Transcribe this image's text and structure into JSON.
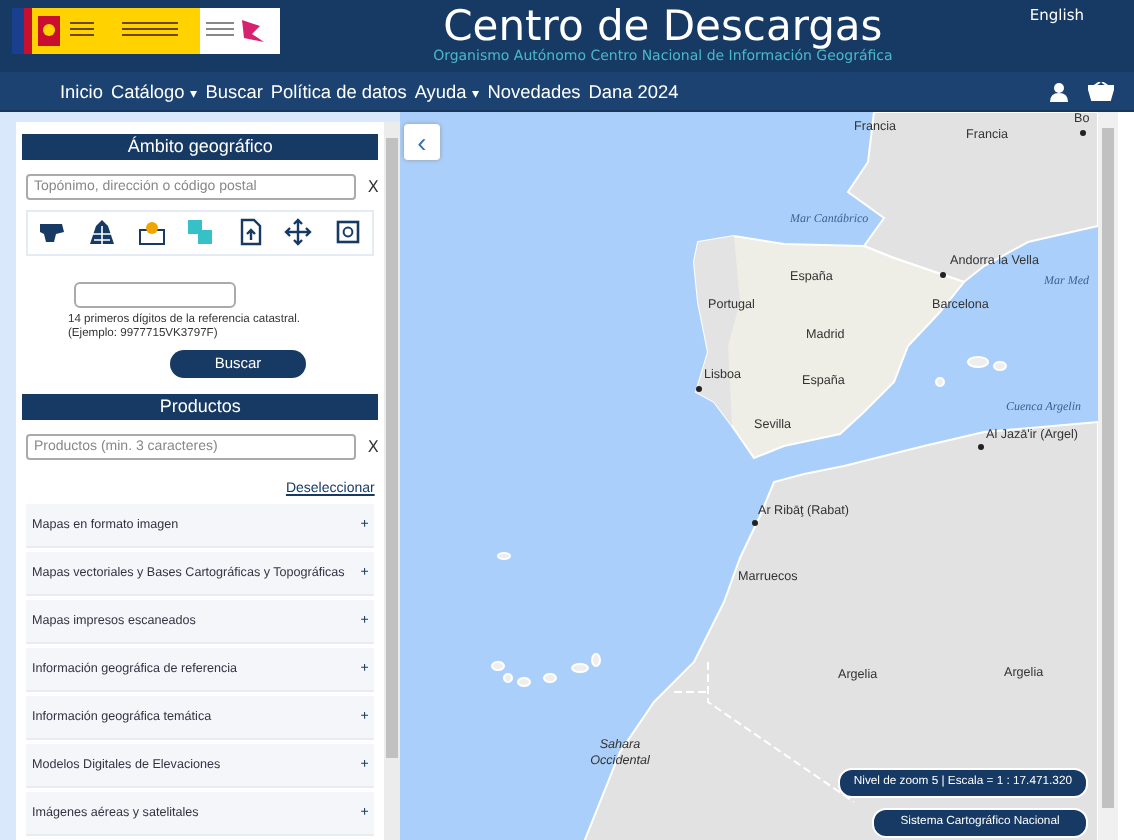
{
  "header": {
    "title": "Centro de Descargas",
    "subtitle": "Organismo Autónomo Centro Nacional de Información Geográfica",
    "language": "English"
  },
  "nav": {
    "items": [
      {
        "label": "Inicio"
      },
      {
        "label": "Catálogo",
        "caret": "▾"
      },
      {
        "label": "Buscar"
      },
      {
        "label": "Política de datos"
      },
      {
        "label": "Ayuda",
        "caret": "▾"
      },
      {
        "label": "Novedades"
      },
      {
        "label": "Dana 2024"
      }
    ]
  },
  "geo_panel": {
    "title": "Ámbito geográfico",
    "search": {
      "placeholder": "Topónimo, dirección o código postal"
    },
    "clear": "X",
    "tools": [
      {
        "selected": false
      },
      {
        "selected": false
      },
      {
        "selected": false
      },
      {
        "selected": true
      },
      {
        "selected": false
      },
      {
        "selected": false
      },
      {
        "selected": false
      }
    ],
    "cadastral": {
      "hint_lines": [
        "14 primeros dígitos de la referencia catastral.",
        "(Ejemplo: 9977715VK3797F)"
      ],
      "button": "Buscar"
    }
  },
  "products_panel": {
    "title": "Productos",
    "search": {
      "placeholder": "Productos (min. 3 caracteres)"
    },
    "clear": "X",
    "deselect": "Deseleccionar",
    "categories": [
      {
        "label": "Mapas en formato imagen",
        "expander": "+"
      },
      {
        "label": "Mapas vectoriales y Bases Cartográficas y Topográficas",
        "expander": "+"
      },
      {
        "label": "Mapas impresos escaneados",
        "expander": "+"
      },
      {
        "label": "Información geográfica de referencia",
        "expander": "+"
      },
      {
        "label": "Información geográfica temática",
        "expander": "+"
      },
      {
        "label": "Modelos Digitales de Elevaciones",
        "expander": "+"
      },
      {
        "label": "Imágenes aéreas y satelitales",
        "expander": "+"
      }
    ]
  },
  "map": {
    "collapse_button": "‹",
    "labels": [
      {
        "text": "Bo",
        "kind": "city"
      },
      {
        "text": "Francia",
        "kind": "country"
      },
      {
        "text": "Francia",
        "kind": "country"
      },
      {
        "text": "Mar Cantábrico",
        "kind": "sea"
      },
      {
        "text": "Andorra la Vella",
        "kind": "city"
      },
      {
        "text": "Mar Med",
        "kind": "sea"
      },
      {
        "text": "España",
        "kind": "country"
      },
      {
        "text": "Portugal",
        "kind": "country"
      },
      {
        "text": "Barcelona",
        "kind": "place"
      },
      {
        "text": "Madrid",
        "kind": "place"
      },
      {
        "text": "Lisboa",
        "kind": "city"
      },
      {
        "text": "España",
        "kind": "country"
      },
      {
        "text": "Sevilla",
        "kind": "place"
      },
      {
        "text": "Cuenca Argelin",
        "kind": "sea"
      },
      {
        "text": "Al Jazā'ir (Argel)",
        "kind": "city"
      },
      {
        "text": "Ar Ribāţ (Rabat)",
        "kind": "city"
      },
      {
        "text": "Marruecos",
        "kind": "country"
      },
      {
        "text": "Argelia",
        "kind": "country"
      },
      {
        "text": "Argelia",
        "kind": "country"
      },
      {
        "text": "Sahara Occidental",
        "kind": "region"
      }
    ],
    "scale": "Nivel de zoom 5 | Escala = 1 : 17.471.320",
    "attribution": "Sistema Cartográfico Nacional"
  }
}
